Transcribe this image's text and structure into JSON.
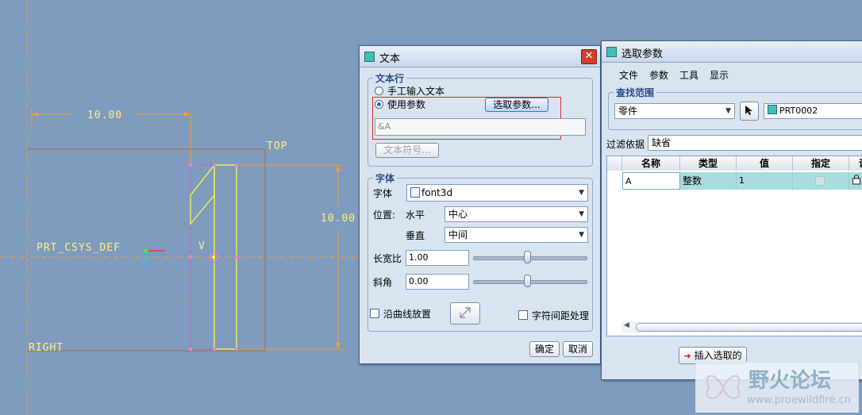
{
  "cad": {
    "dim_horizontal": "10.00",
    "dim_vertical": "10.00",
    "plane_top": "TOP",
    "plane_right": "RIGHT",
    "csys_label": "PRT_CSYS_DEF",
    "point_label": "V"
  },
  "text_dialog": {
    "title": "文本",
    "close_glyph": "✕",
    "text_line_group": "文本行",
    "radio_manual": "手工输入文本",
    "radio_param": "使用参数",
    "select_param_button": "选取参数...",
    "text_value": "&A",
    "text_symbol_button": "文本符号...",
    "font_group": "字体",
    "font_label": "字体",
    "font_value": "font3d",
    "position_label": "位置:",
    "horizontal_label": "水平",
    "horizontal_value": "中心",
    "vertical_label": "垂直",
    "vertical_value": "中间",
    "aspect_label": "长宽比",
    "aspect_value": "1.00",
    "aspect_slider_fraction": 0.48,
    "slant_label": "斜角",
    "slant_value": "0.00",
    "slant_slider_fraction": 0.48,
    "along_curve_label": "沿曲线放置",
    "char_spacing_label": "字符间距处理",
    "ok_button": "确定",
    "cancel_button": "取消"
  },
  "param_dialog": {
    "title": "选取参数",
    "menu": [
      "文件",
      "参数",
      "工具",
      "显示"
    ],
    "search_group": "查找范围",
    "scope_value": "零件",
    "model_value": "PRT0002",
    "filter_label": "过滤依据",
    "filter_value": "缺省",
    "columns": [
      "名称",
      "类型",
      "值",
      "指定",
      "说"
    ],
    "rows": [
      {
        "name": "A",
        "type": "整数",
        "value": "1"
      }
    ],
    "insert_button": "插入选取的"
  },
  "watermark": {
    "title": "野火论坛",
    "url": "www.proewildfire.cn"
  },
  "colors": {
    "viewport": "#7f9bbd",
    "dim_line": "#e8a23a",
    "datum_line": "#c8782a",
    "sketch_line": "#ffff40",
    "selection_highlight": "#d03030"
  }
}
